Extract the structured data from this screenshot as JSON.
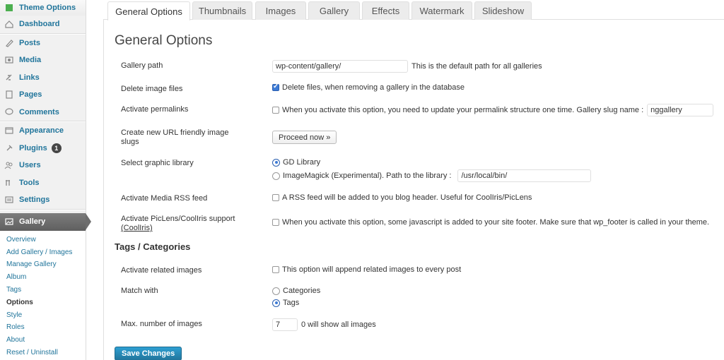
{
  "sidebar": {
    "menu": [
      {
        "label": "Theme Options",
        "icon": "theme-options-icon"
      },
      {
        "label": "Dashboard",
        "icon": "dashboard-icon"
      },
      {
        "label": "Posts",
        "icon": "posts-icon"
      },
      {
        "label": "Media",
        "icon": "media-icon"
      },
      {
        "label": "Links",
        "icon": "links-icon"
      },
      {
        "label": "Pages",
        "icon": "pages-icon"
      },
      {
        "label": "Comments",
        "icon": "comments-icon"
      },
      {
        "label": "Appearance",
        "icon": "appearance-icon"
      },
      {
        "label": "Plugins",
        "icon": "plugins-icon",
        "badge": "1"
      },
      {
        "label": "Users",
        "icon": "users-icon"
      },
      {
        "label": "Tools",
        "icon": "tools-icon"
      },
      {
        "label": "Settings",
        "icon": "settings-icon"
      }
    ],
    "gallery": {
      "label": "Gallery",
      "icon": "gallery-icon",
      "submenu": [
        "Overview",
        "Add Gallery / Images",
        "Manage Gallery",
        "Album",
        "Tags",
        "Options",
        "Style",
        "Roles",
        "About",
        "Reset / Uninstall"
      ],
      "current": "Options"
    }
  },
  "tabs": [
    "General Options",
    "Thumbnails",
    "Images",
    "Gallery",
    "Effects",
    "Watermark",
    "Slideshow"
  ],
  "active_tab": "General Options",
  "page_title": "General Options",
  "settings": {
    "gallery_path": {
      "label": "Gallery path",
      "value": "wp-content/gallery/",
      "help": "This is the default path for all galleries"
    },
    "delete_files": {
      "label": "Delete image files",
      "checked": true,
      "text": "Delete files, when removing a gallery in the database"
    },
    "permalinks": {
      "label": "Activate permalinks",
      "checked": false,
      "text": "When you activate this option, you need to update your permalink structure one time. Gallery slug name :",
      "slug_value": "nggallery"
    },
    "url_slugs": {
      "label": "Create new URL friendly image slugs",
      "button": "Proceed now »"
    },
    "graphic_library": {
      "label": "Select graphic library",
      "option_gd": "GD Library",
      "option_imagemagick": "ImageMagick (Experimental). Path to the library :",
      "path_value": "/usr/local/bin/",
      "selected": "GD Library"
    },
    "media_rss": {
      "label": "Activate Media RSS feed",
      "checked": false,
      "text": "A RSS feed will be added to you blog header. Useful for CoolIris/PicLens"
    },
    "piclens": {
      "label": "Activate PicLens/CoolIris support",
      "link": "(CoolIris)",
      "checked": false,
      "text": "When you activate this option, some javascript is added to your site footer. Make sure that wp_footer is called in your theme."
    }
  },
  "tags_section": {
    "heading": "Tags / Categories",
    "related": {
      "label": "Activate related images",
      "checked": false,
      "text": "This option will append related images to every post"
    },
    "match_with": {
      "label": "Match with",
      "option_categories": "Categories",
      "option_tags": "Tags",
      "selected": "Tags"
    },
    "max_images": {
      "label": "Max. number of images",
      "value": "7",
      "help": "0 will show all images"
    }
  },
  "save_button": "Save Changes",
  "colors": {
    "link": "#21759b",
    "primary_button": "#21759b",
    "active_menu": "#6e6e6e"
  }
}
